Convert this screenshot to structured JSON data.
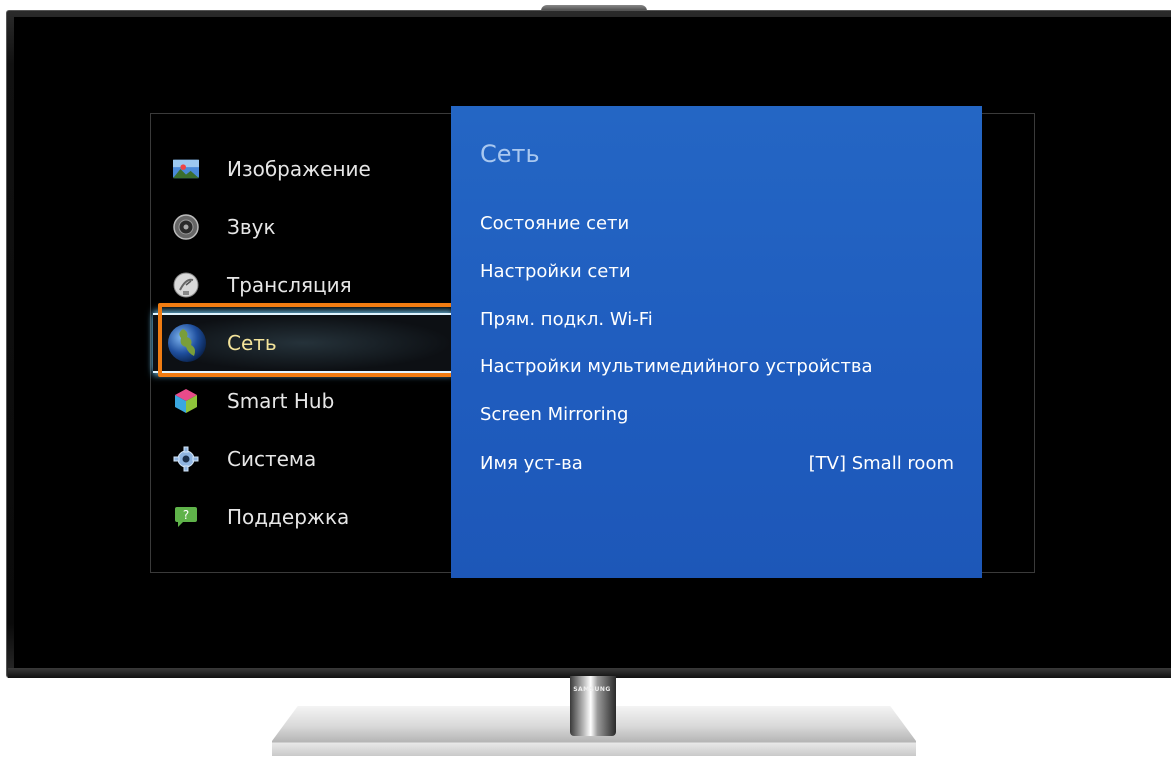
{
  "side_menu": {
    "items": [
      {
        "label": "Изображение",
        "icon": "picture-icon"
      },
      {
        "label": "Звук",
        "icon": "speaker-icon"
      },
      {
        "label": "Трансляция",
        "icon": "satellite-dish-icon"
      },
      {
        "label": "Сеть",
        "icon": "globe-icon",
        "selected": true
      },
      {
        "label": "Smart Hub",
        "icon": "smart-hub-cube-icon"
      },
      {
        "label": "Система",
        "icon": "gear-icon"
      },
      {
        "label": "Поддержка",
        "icon": "help-bubble-icon"
      }
    ]
  },
  "submenu": {
    "title": "Сеть",
    "items": [
      {
        "label": "Состояние сети"
      },
      {
        "label": "Настройки сети"
      },
      {
        "label": "Прям. подкл. Wi-Fi"
      },
      {
        "label": "Настройки мультимедийного устройства"
      },
      {
        "label": "Screen Mirroring"
      },
      {
        "label": "Имя уст-ва",
        "value": "[TV] Small room"
      }
    ]
  },
  "brand": "SAMSUNG",
  "colors": {
    "submenu_bg": "#2161c1",
    "highlight_border": "#f07c12",
    "selected_label": "#f3e39a"
  }
}
